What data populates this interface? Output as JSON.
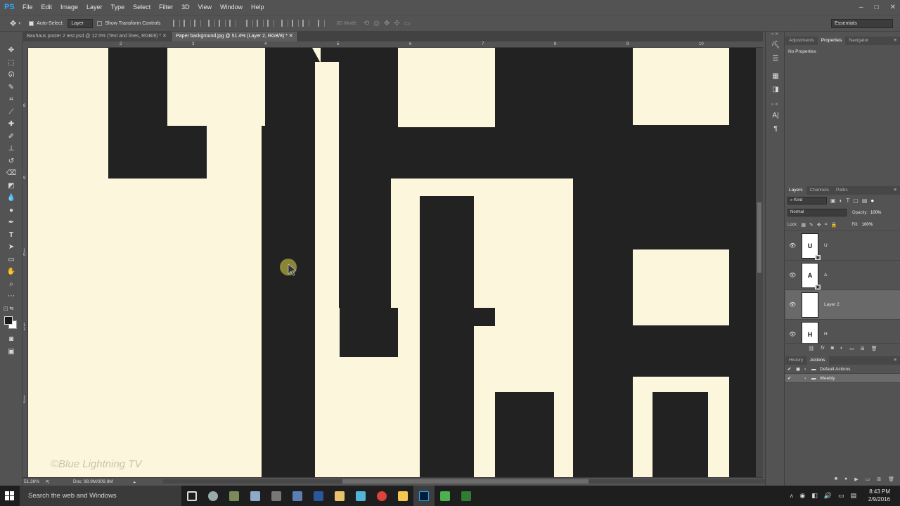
{
  "app": {
    "logo": "PS"
  },
  "menu": [
    "File",
    "Edit",
    "Image",
    "Layer",
    "Type",
    "Select",
    "Filter",
    "3D",
    "View",
    "Window",
    "Help"
  ],
  "window_controls": [
    "–",
    "□",
    "✕"
  ],
  "options": {
    "auto_select_label": "Auto-Select:",
    "auto_select_value": "Layer",
    "transform_label": "Show Transform Controls",
    "mode_3d": "3D Mode:",
    "workspace": "Essentials"
  },
  "doc_tabs": [
    {
      "label": "Bauhaus poster 2 test.psd @ 12.5% (Text and lines, RGB/8) *"
    },
    {
      "label": "Paper background.jpg @ 51.4% (Layer 2, RGB/8) *"
    }
  ],
  "ruler_h": [
    "2",
    "3",
    "4",
    "5",
    "6",
    "7",
    "8",
    "9",
    "10"
  ],
  "ruler_v": [
    "8",
    "9",
    "1 0",
    "1 1",
    "1 2"
  ],
  "status": {
    "zoom": "51.38%",
    "doc": "Doc: 98.9M/309.8M"
  },
  "panel_top": {
    "tabs": [
      "Adjustments",
      "Properties",
      "Navigator"
    ],
    "active_tab": "Properties",
    "content": "No Properties"
  },
  "layers_panel": {
    "tabs": [
      "Layers",
      "Channels",
      "Paths"
    ],
    "filter": "Kind",
    "blend_mode": "Normal",
    "opacity_label": "Opacity:",
    "opacity": "100%",
    "lock_label": "Lock:",
    "fill_label": "Fill:",
    "fill": "100%",
    "layers": [
      {
        "name": "U",
        "thumb": "U",
        "selected": false
      },
      {
        "name": "A",
        "thumb": "A",
        "selected": false
      },
      {
        "name": "Layer 2",
        "thumb": "",
        "selected": true
      },
      {
        "name": "H",
        "thumb": "H",
        "selected": false
      }
    ]
  },
  "actions_panel": {
    "tabs": [
      "History",
      "Actions"
    ],
    "active_tab": "Actions",
    "items": [
      "Default Actions",
      "Weebly"
    ]
  },
  "canvas": {
    "watermark": "©Blue Lightning TV",
    "paper_color": "#fcf7dc",
    "ink_color": "#222222"
  },
  "taskbar": {
    "search": "Search the web and Windows",
    "time": "8:43 PM",
    "date": "2/9/2016"
  }
}
